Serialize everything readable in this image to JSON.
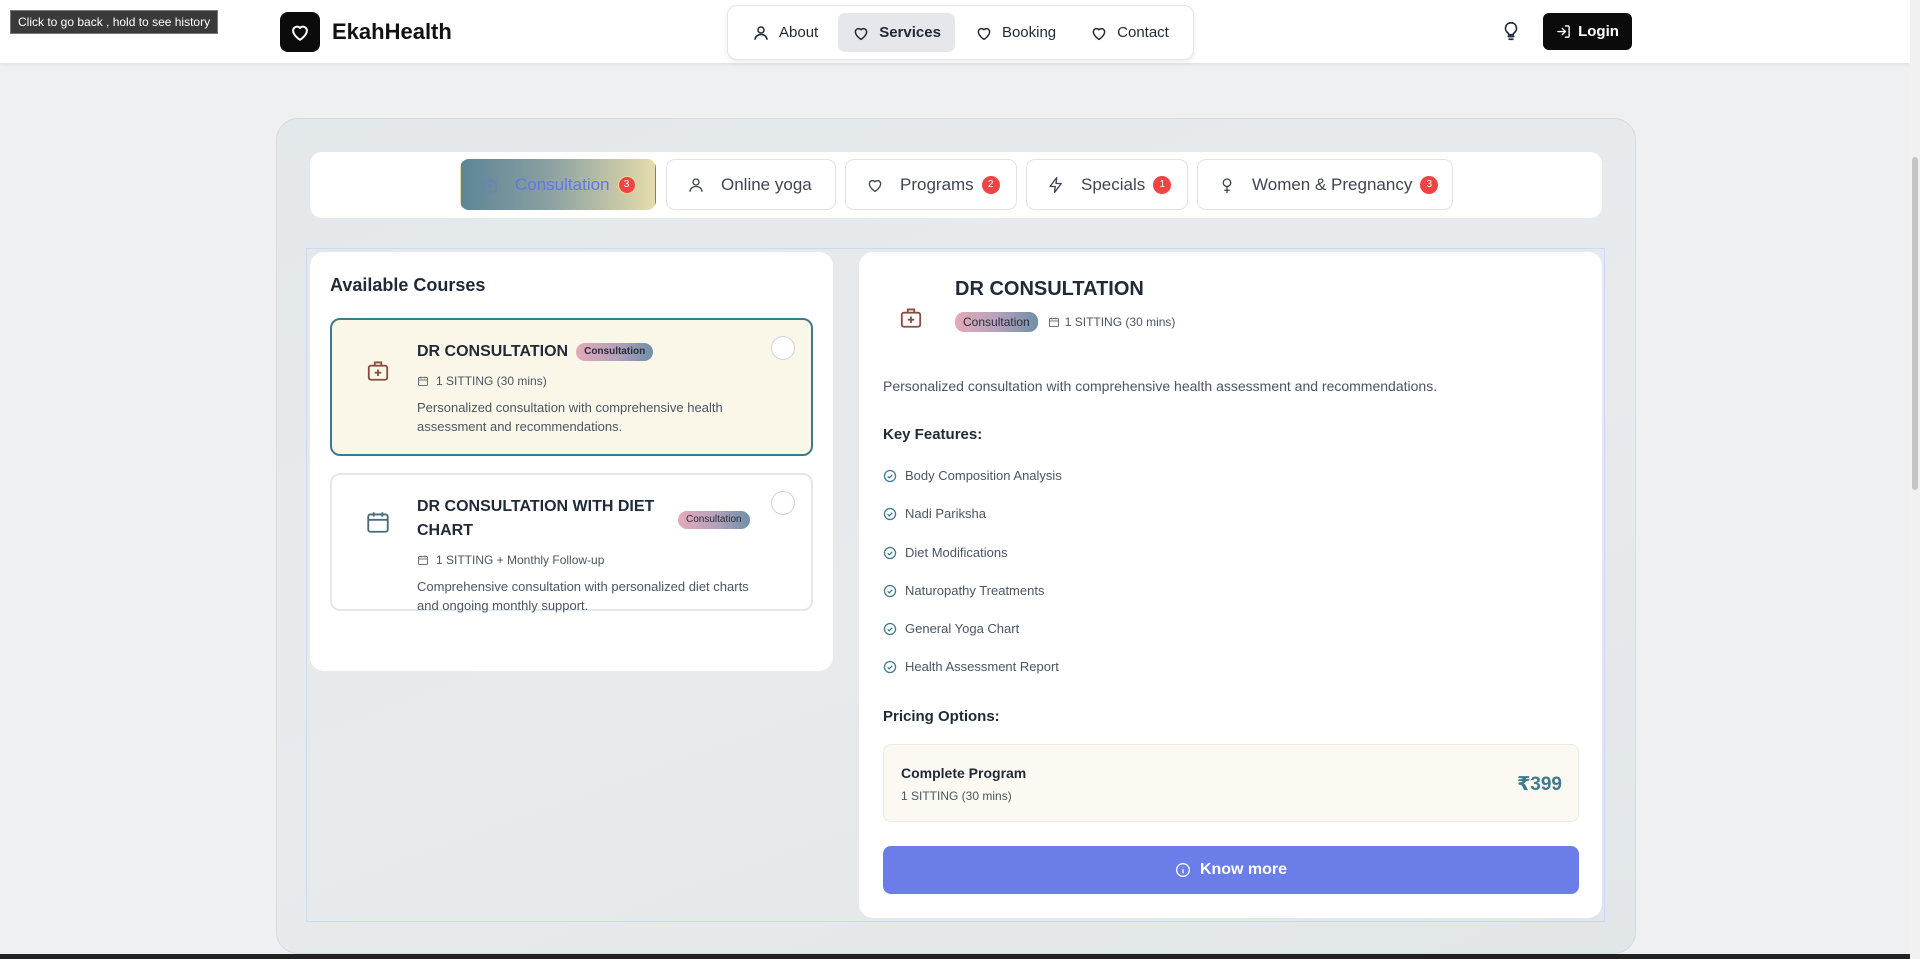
{
  "tooltip": "Click to go back , hold to see history",
  "header": {
    "brand_name": "EkahHealth",
    "nav": [
      {
        "label": "About",
        "icon": "user-icon"
      },
      {
        "label": "Services",
        "icon": "heart-icon",
        "active": true
      },
      {
        "label": "Booking",
        "icon": "heart-icon"
      },
      {
        "label": "Contact",
        "icon": "heart-icon"
      }
    ],
    "login_label": "Login"
  },
  "tabs": [
    {
      "label": "Consultation",
      "badge": "3",
      "icon": "hospital-icon",
      "active": true
    },
    {
      "label": "Online yoga",
      "icon": "user-icon"
    },
    {
      "label": "Programs",
      "badge": "2",
      "icon": "heart-icon"
    },
    {
      "label": "Specials",
      "badge": "1",
      "icon": "lightning-icon"
    },
    {
      "label": "Women & Pregnancy",
      "badge": "3",
      "icon": "female-icon"
    }
  ],
  "courses_panel": {
    "title": "Available Courses",
    "courses": [
      {
        "name": "DR CONSULTATION",
        "tag": "Consultation",
        "duration": "1 SITTING (30 mins)",
        "description": "Personalized consultation with comprehensive health assessment and recommendations.",
        "selected": true
      },
      {
        "name": "DR CONSULTATION WITH DIET CHART",
        "tag": "Consultation",
        "duration": "1 SITTING + Monthly Follow-up",
        "description": "Comprehensive consultation with personalized diet charts and ongoing monthly support.",
        "selected": false
      }
    ]
  },
  "detail": {
    "title": "DR CONSULTATION",
    "tag": "Consultation",
    "duration": "1 SITTING (30 mins)",
    "description": "Personalized consultation with comprehensive health assessment and recommendations.",
    "features_heading": "Key Features:",
    "features": [
      "Body Composition Analysis",
      "Nadi Pariksha",
      "Diet Modifications",
      "Naturopathy Treatments",
      "General Yoga Chart",
      "Health Assessment Report"
    ],
    "pricing_heading": "Pricing Options:",
    "pricing": {
      "title": "Complete Program",
      "subtitle": "1 SITTING (30 mins)",
      "price": "₹399"
    },
    "know_more_label": "Know more"
  },
  "colors": {
    "accent": "#6a7de8",
    "teal": "#3e7a8d",
    "badge": "#ef4444"
  }
}
